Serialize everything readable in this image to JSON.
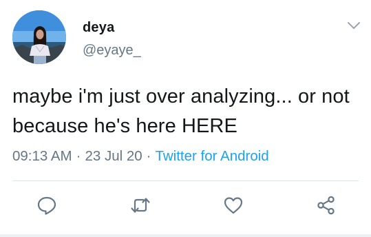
{
  "user": {
    "display_name": "deya",
    "handle": "@eyaye_",
    "avatar_icon": "profile-photo"
  },
  "tweet": {
    "text": "maybe i'm just over analyzing... or not because he's here HERE",
    "time": "09:13 AM",
    "separator": "·",
    "date": "23 Jul 20",
    "source": "Twitter for Android"
  },
  "actions": {
    "reply_icon": "reply-icon",
    "retweet_icon": "retweet-icon",
    "like_icon": "like-icon",
    "share_icon": "share-icon"
  },
  "colors": {
    "text": "#14171a",
    "secondary": "#657786",
    "accent": "#1da1f2",
    "divider": "#dfe4e8"
  }
}
